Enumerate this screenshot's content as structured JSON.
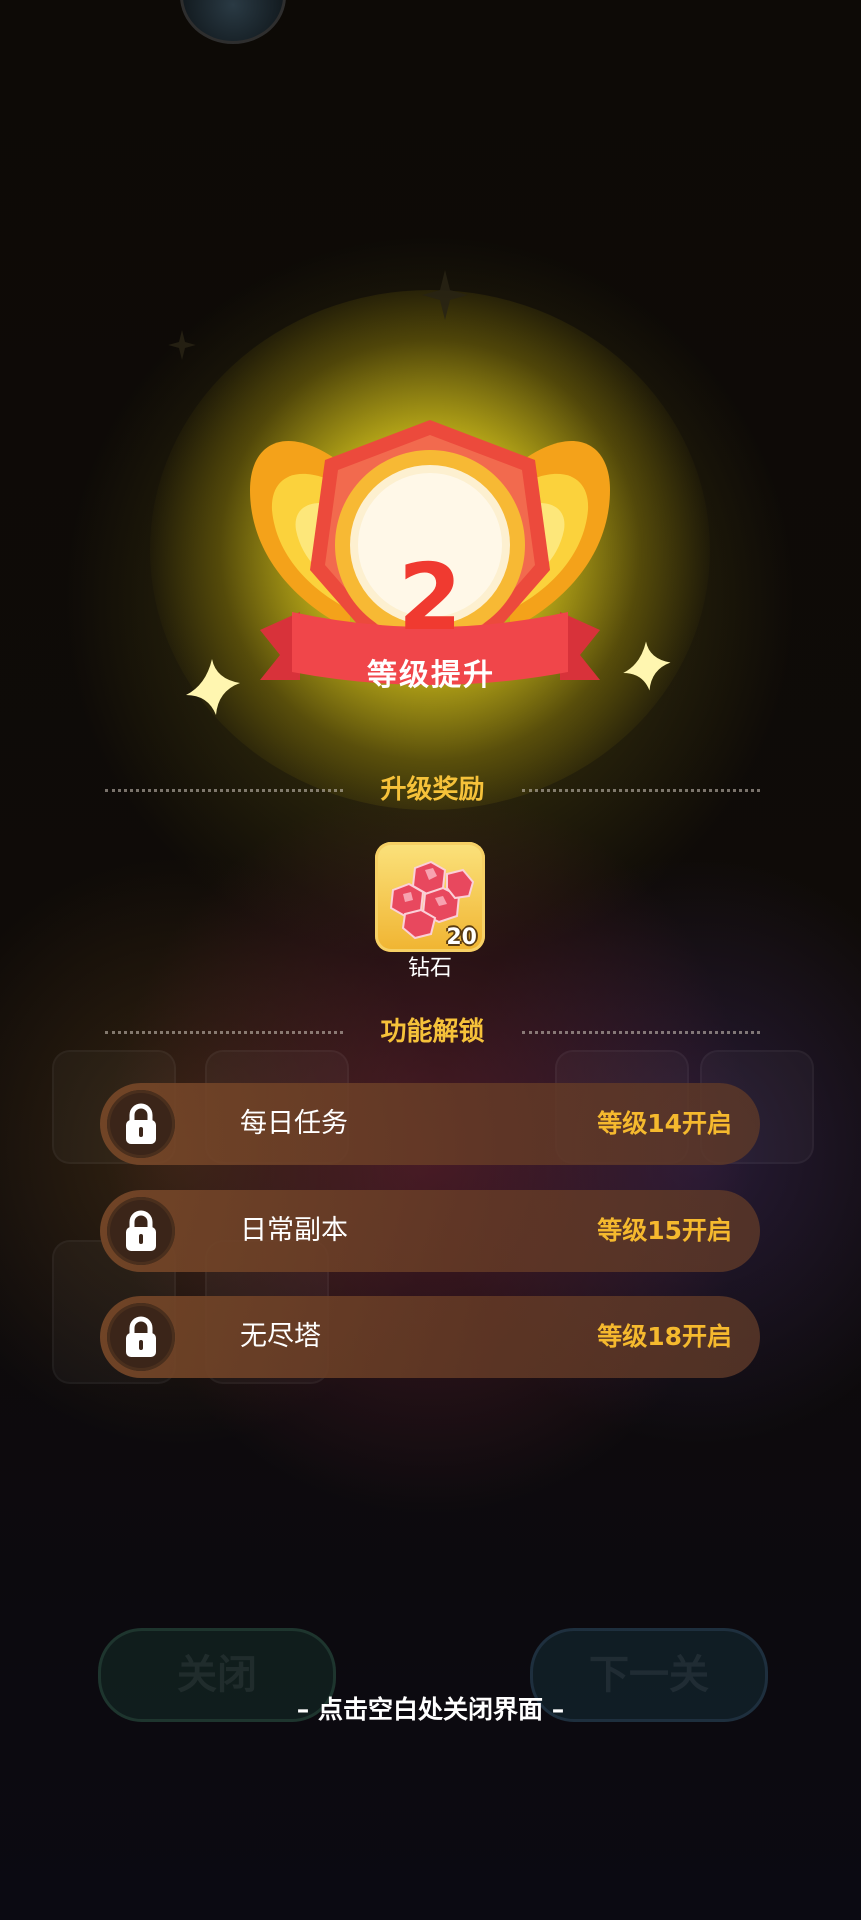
{
  "level_up": {
    "level": "2",
    "ribbon_label": "等级提升"
  },
  "rewards": {
    "header": "升级奖励",
    "items": [
      {
        "name": "钻石",
        "count": "20",
        "icon": "diamond-gems-icon"
      }
    ]
  },
  "unlocks": {
    "header": "功能解锁",
    "items": [
      {
        "name": "每日任务",
        "requirement": "等级14开启",
        "icon": "lock-icon"
      },
      {
        "name": "日常副本",
        "requirement": "等级15开启",
        "icon": "lock-icon"
      },
      {
        "name": "无尽塔",
        "requirement": "等级18开启",
        "icon": "lock-icon"
      }
    ]
  },
  "background_buttons": {
    "close_label": "关闭",
    "next_label": "下一关"
  },
  "hint": "– 点击空白处关闭界面 –",
  "colors": {
    "accent_gold": "#f6c23a",
    "level_red": "#f03a30",
    "requirement_gold": "#f5b92e",
    "row_brown": "#784828"
  }
}
